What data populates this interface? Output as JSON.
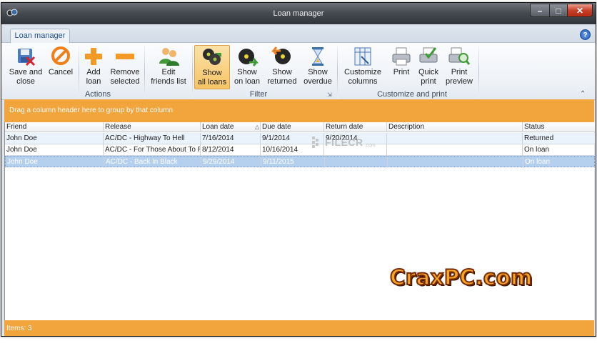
{
  "window": {
    "title": "Loan manager"
  },
  "tab": {
    "label": "Loan manager"
  },
  "ribbon": {
    "buttons": {
      "save_close": "Save and\nclose",
      "cancel": "Cancel",
      "add_loan": "Add\nloan",
      "remove_selected": "Remove\nselected",
      "edit_friends": "Edit\nfriends list",
      "show_all": "Show\nall loans",
      "show_on_loan": "Show\non loan",
      "show_returned": "Show\nreturned",
      "show_overdue": "Show\noverdue",
      "customize_columns": "Customize\ncolumns",
      "print": "Print",
      "quick_print": "Quick\nprint",
      "print_preview": "Print\npreview"
    },
    "groups": {
      "actions": "Actions",
      "filter": "Filter",
      "customize_print": "Customize and print"
    }
  },
  "group_panel": {
    "text": "Drag a column header here to group by that column"
  },
  "grid": {
    "columns": [
      "Friend",
      "Release",
      "Loan date",
      "Due date",
      "Return date",
      "Description",
      "Status"
    ],
    "rows": [
      {
        "friend": "John Doe",
        "release": "AC/DC - Highway To Hell",
        "loan_date": "7/16/2014",
        "due_date": "9/1/2014",
        "return_date": "9/20/2014",
        "description": "",
        "status": "Returned"
      },
      {
        "friend": "John Doe",
        "release": "AC/DC - For Those About To Roc",
        "loan_date": "8/12/2014",
        "due_date": "10/16/2014",
        "return_date": "",
        "description": "",
        "status": "On loan"
      },
      {
        "friend": "John Doe",
        "release": "AC/DC - Back In Black",
        "loan_date": "9/29/2014",
        "due_date": "9/11/2015",
        "return_date": "",
        "description": "",
        "status": "On loan"
      }
    ]
  },
  "status_bar": {
    "text": "Items: 3"
  },
  "watermarks": {
    "filecr": "FILECR",
    "filecr_sub": ".com",
    "crax": "CraxPC.com"
  },
  "colors": {
    "accent": "#f2a43d",
    "selection": "#b5cfef",
    "active_button": "#f6c465"
  },
  "icons": [
    "app-icon",
    "help-icon",
    "save-icon",
    "cancel-icon",
    "add-icon",
    "remove-icon",
    "friends-icon",
    "all-loans-icon",
    "on-loan-icon",
    "returned-icon",
    "overdue-icon",
    "columns-icon",
    "print-icon",
    "quick-print-icon",
    "print-preview-icon"
  ]
}
